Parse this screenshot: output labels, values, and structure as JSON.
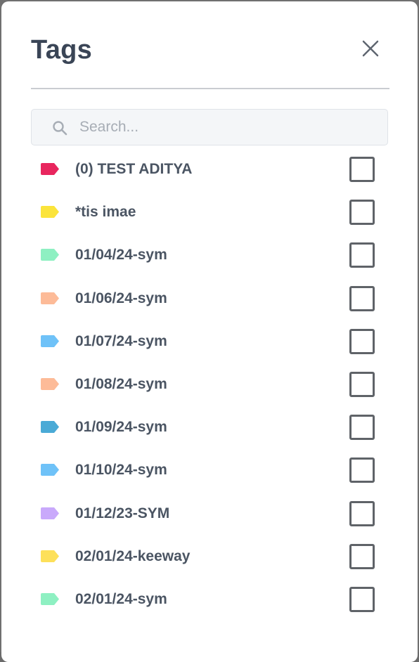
{
  "dialog": {
    "title": "Tags"
  },
  "search": {
    "placeholder": "Search...",
    "value": ""
  },
  "tags": [
    {
      "label": "(0) TEST ADITYA",
      "color": "#e8265e",
      "checked": false
    },
    {
      "label": "*tis imae",
      "color": "#fbe43b",
      "checked": false
    },
    {
      "label": "01/04/24-sym",
      "color": "#8ef0c2",
      "checked": false
    },
    {
      "label": "01/06/24-sym",
      "color": "#fdbb98",
      "checked": false
    },
    {
      "label": "01/07/24-sym",
      "color": "#6fc2f8",
      "checked": false
    },
    {
      "label": "01/08/24-sym",
      "color": "#fdbb98",
      "checked": false
    },
    {
      "label": "01/09/24-sym",
      "color": "#4aaad6",
      "checked": false
    },
    {
      "label": "01/10/24-sym",
      "color": "#6fc2f8",
      "checked": false
    },
    {
      "label": "01/12/23-SYM",
      "color": "#c9a9fb",
      "checked": false
    },
    {
      "label": "02/01/24-keeway",
      "color": "#fde05a",
      "checked": false
    },
    {
      "label": "02/01/24-sym",
      "color": "#8ef0c2",
      "checked": false
    }
  ]
}
